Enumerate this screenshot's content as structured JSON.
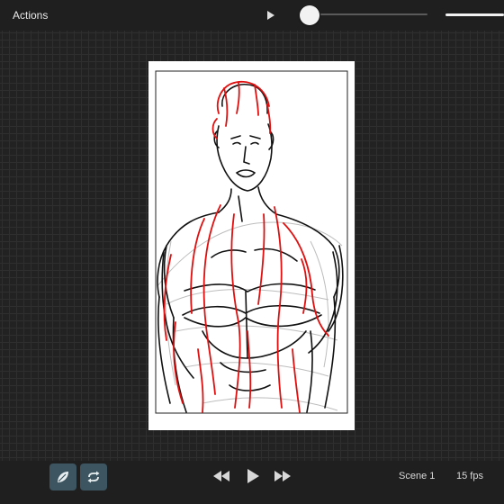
{
  "topbar": {
    "actions_label": "Actions",
    "play_icon": "play-icon",
    "opacity_slider": {
      "value_fraction": 0.0
    }
  },
  "canvas": {
    "background": "#222222",
    "paper_color": "#ffffff",
    "sketch_colors": {
      "ink": "#111111",
      "red": "#e01010",
      "gray": "#bdbdbd"
    }
  },
  "bottombar": {
    "onion_skin_icon": "onion-skin-icon",
    "loop_icon": "loop-icon",
    "rewind_icon": "rewind-icon",
    "play_icon": "play-icon",
    "fast_forward_icon": "fast-forward-icon",
    "scene_label": "Scene 1",
    "fps_label": "15 fps",
    "accent": "#3c5560"
  }
}
